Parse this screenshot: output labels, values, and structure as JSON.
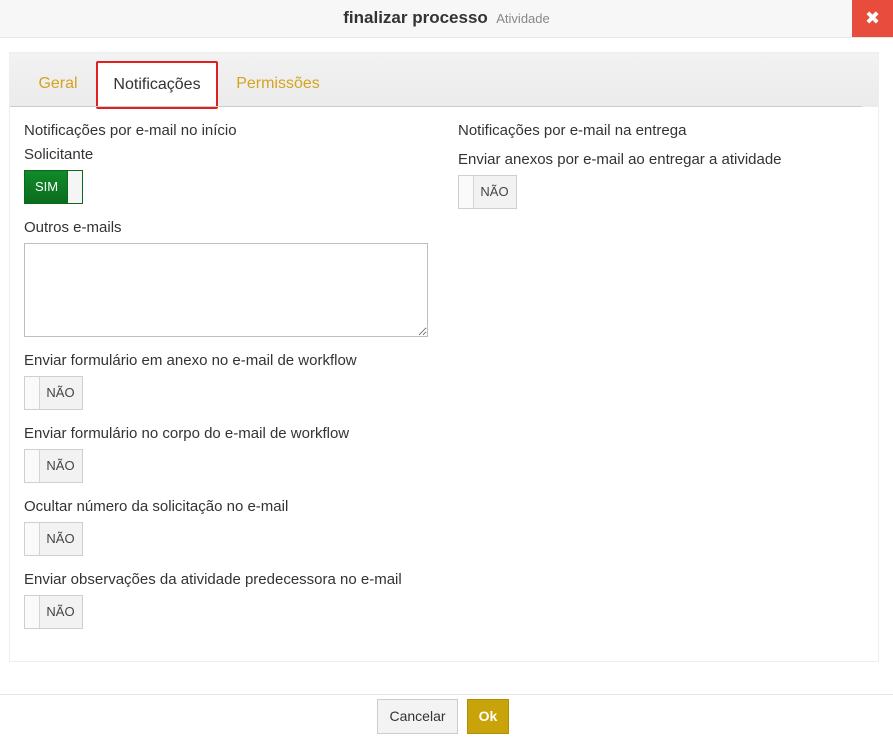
{
  "header": {
    "title": "finalizar processo",
    "subtitle": "Atividade",
    "close_symbol": "✖"
  },
  "tabs": [
    {
      "label": "Geral",
      "active": false
    },
    {
      "label": "Notificações",
      "active": true
    },
    {
      "label": "Permissões",
      "active": false
    }
  ],
  "left": {
    "start_heading": "Notificações por e-mail no início",
    "requester_label": "Solicitante",
    "requester_toggle": "SIM",
    "other_emails_label": "Outros e-mails",
    "other_emails_value": "",
    "attach_form_label": "Enviar formulário em anexo no e-mail de workflow",
    "attach_form_toggle": "NÃO",
    "body_form_label": "Enviar formulário no corpo do e-mail de workflow",
    "body_form_toggle": "NÃO",
    "hide_number_label": "Ocultar número da solicitação no e-mail",
    "hide_number_toggle": "NÃO",
    "predecessor_notes_label": "Enviar observações da atividade predecessora no e-mail",
    "predecessor_notes_toggle": "NÃO"
  },
  "right": {
    "delivery_heading": "Notificações por e-mail na entrega",
    "send_attachments_label": "Enviar anexos por e-mail ao entregar a atividade",
    "send_attachments_toggle": "NÃO"
  },
  "footer": {
    "cancel_label": "Cancelar",
    "ok_label": "Ok"
  },
  "colors": {
    "accent_gold": "#c9a30a",
    "tab_inactive": "#d4a320",
    "toggle_on": "#0a6d1e",
    "close_red": "#e74c3c",
    "highlight_red": "#e02020"
  },
  "icons": {
    "close": "close-icon"
  }
}
